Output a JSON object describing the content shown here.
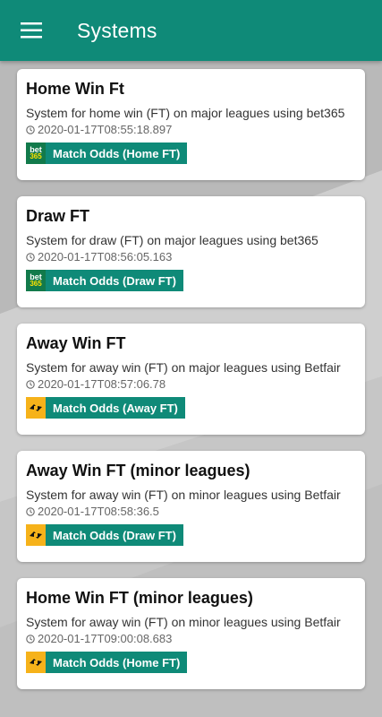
{
  "appbar": {
    "title": "Systems",
    "menu_icon": "hamburger-menu-icon"
  },
  "colors": {
    "primary": "#0f8a78",
    "bet365": "#127a4b",
    "betfair": "#f6b21a"
  },
  "systems": [
    {
      "title": "Home Win Ft",
      "description": "System for home win (FT) on major leagues using bet365",
      "timestamp": "2020-01-17T08:55:18.897",
      "provider": "bet365",
      "logo_text_1": "bet",
      "logo_text_2": "365",
      "market": "Match Odds (Home FT)"
    },
    {
      "title": "Draw FT",
      "description": "System for draw (FT) on major leagues using bet365",
      "timestamp": "2020-01-17T08:56:05.163",
      "provider": "bet365",
      "logo_text_1": "bet",
      "logo_text_2": "365",
      "market": "Match Odds (Draw FT)"
    },
    {
      "title": "Away Win FT",
      "description": "System for away win (FT) on major leagues using Betfair",
      "timestamp": "2020-01-17T08:57:06.78",
      "provider": "betfair",
      "market": "Match Odds (Away FT)"
    },
    {
      "title": "Away Win FT (minor leagues)",
      "description": "System for away win (FT) on minor leagues using Betfair",
      "timestamp": "2020-01-17T08:58:36.5",
      "provider": "betfair",
      "market": "Match Odds (Draw FT)"
    },
    {
      "title": "Home Win FT (minor leagues)",
      "description": "System for away win (FT) on minor leagues using Betfair",
      "timestamp": "2020-01-17T09:00:08.683",
      "provider": "betfair",
      "market": "Match Odds (Home FT)"
    }
  ]
}
